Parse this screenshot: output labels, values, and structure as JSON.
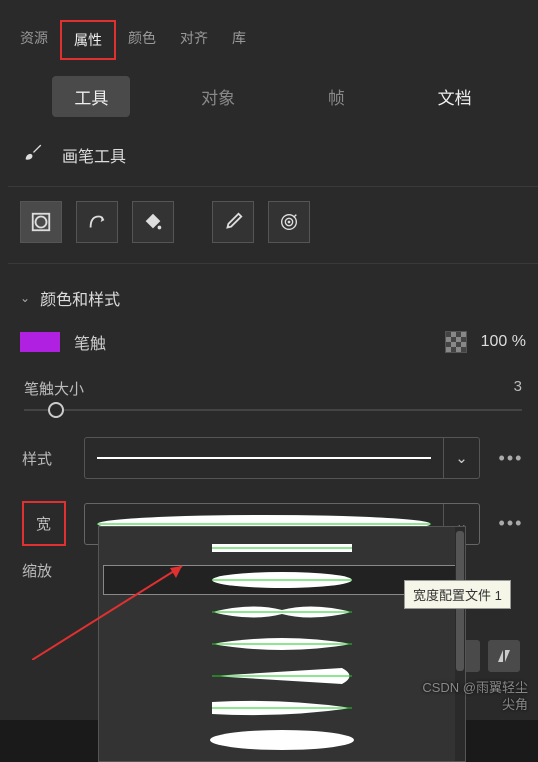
{
  "topTabs": {
    "resources": "资源",
    "properties": "属性",
    "color": "颜色",
    "align": "对齐",
    "library": "库"
  },
  "subTabs": {
    "tool": "工具",
    "object": "对象",
    "frame": "帧",
    "document": "文档"
  },
  "toolName": "画笔工具",
  "section": {
    "colorStyle": "颜色和样式"
  },
  "stroke": {
    "label": "笔触",
    "color": "#b020e0",
    "opacity": "100 %"
  },
  "strokeSize": {
    "label": "笔触大小",
    "value": "3"
  },
  "style": {
    "label": "样式"
  },
  "width": {
    "label": "宽"
  },
  "scale": {
    "label": "缩放"
  },
  "tooltip": "宽度配置文件 1",
  "watermark": {
    "line1": "CSDN @雨翼轻尘",
    "line2": "尖角"
  }
}
